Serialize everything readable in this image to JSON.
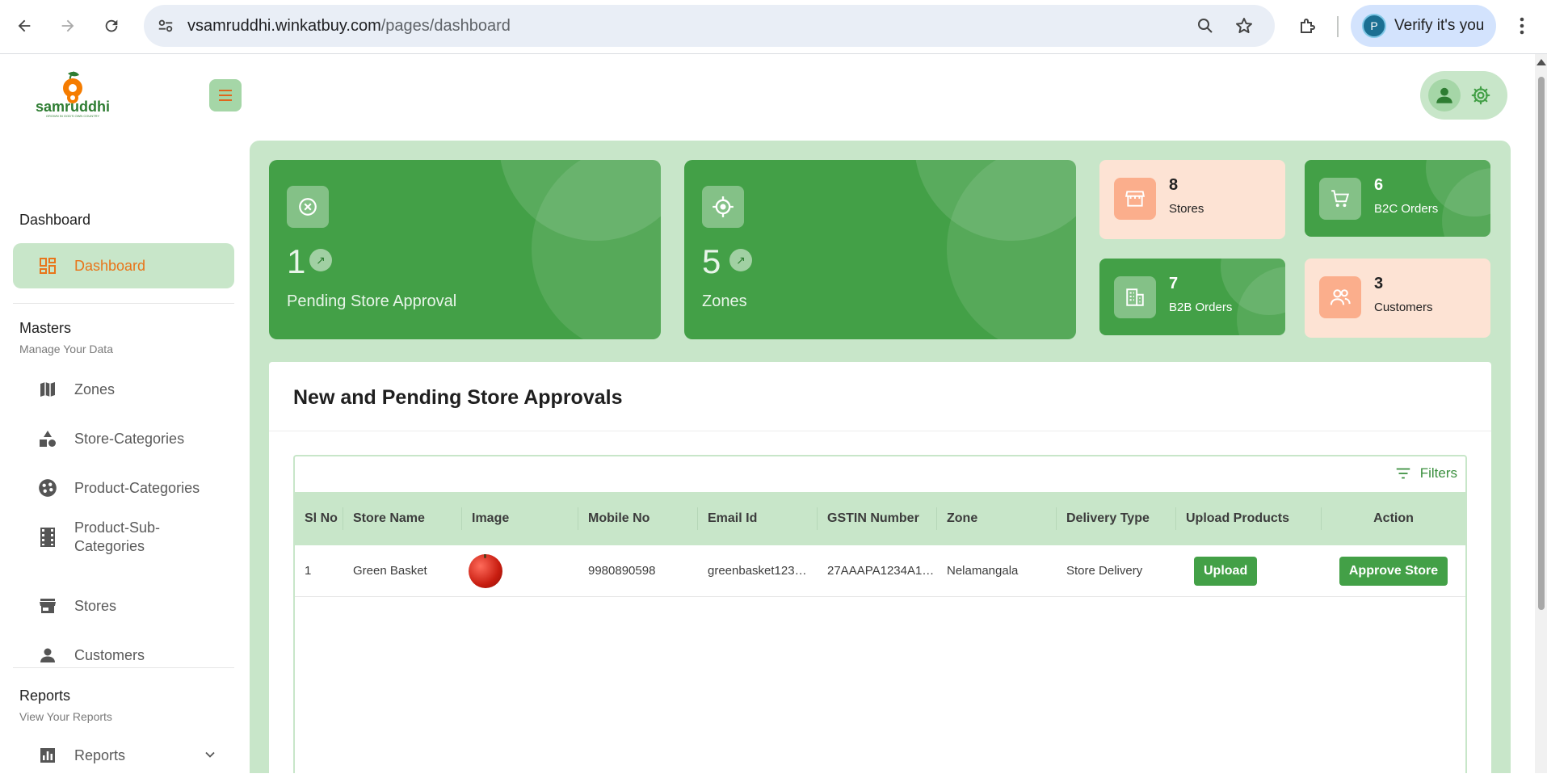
{
  "browser": {
    "url_host": "vsamruddhi.winkatbuy.com",
    "url_path": "/pages/dashboard",
    "profile_initial": "P",
    "verify_label": "Verify it's you"
  },
  "app": {
    "brand_name": "samruddhi",
    "brand_tagline": "GROWN IN GOD'S OWN COUNTRY"
  },
  "sidebar": {
    "dashboard_section": "Dashboard",
    "dashboard_item": "Dashboard",
    "masters_section": "Masters",
    "masters_sub": "Manage Your Data",
    "items": [
      {
        "label": "Zones",
        "icon": "map-icon"
      },
      {
        "label": "Store-Categories",
        "icon": "shapes-icon"
      },
      {
        "label": "Product-Categories",
        "icon": "palette-icon"
      },
      {
        "label": "Product-Sub-Categories",
        "icon": "film-icon"
      },
      {
        "label": "Stores",
        "icon": "store-icon"
      },
      {
        "label": "Customers",
        "icon": "person-icon"
      }
    ],
    "reports_section": "Reports",
    "reports_sub": "View Your Reports",
    "reports_item": "Reports"
  },
  "stats": {
    "pending": {
      "value": "1",
      "label": "Pending Store Approval"
    },
    "zones": {
      "value": "5",
      "label": "Zones"
    },
    "stores": {
      "value": "8",
      "label": "Stores"
    },
    "b2c": {
      "value": "6",
      "label": "B2C Orders"
    },
    "b2b": {
      "value": "7",
      "label": "B2B Orders"
    },
    "customers": {
      "value": "3",
      "label": "Customers"
    }
  },
  "approvals": {
    "title": "New and Pending Store Approvals",
    "filters_label": "Filters",
    "columns": [
      "Sl No",
      "Store Name",
      "Image",
      "Mobile No",
      "Email Id",
      "GSTIN Number",
      "Zone",
      "Delivery Type",
      "Upload Products",
      "Action"
    ],
    "rows": [
      {
        "sl": "1",
        "store": "Green Basket",
        "mobile": "9980890598",
        "email": "greenbasket123…",
        "gstin": "27AAAPA1234A1…",
        "zone": "Nelamangala",
        "delivery": "Store Delivery",
        "upload_label": "Upload",
        "action_label": "Approve Store"
      }
    ]
  },
  "colors": {
    "primary_green": "#43a047",
    "light_green": "#c8e6c9",
    "peach": "#fde3d4",
    "accent_orange": "#e8751a"
  }
}
